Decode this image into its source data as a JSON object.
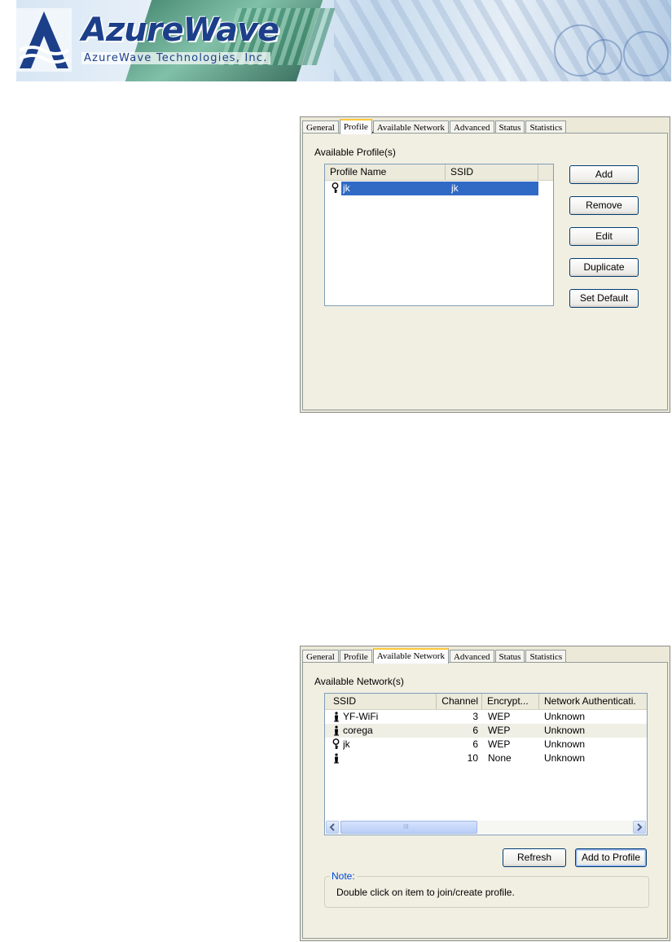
{
  "header": {
    "brand": "AzureWave",
    "company": "AzureWave  Technologies,  Inc."
  },
  "profile_panel": {
    "tabs": [
      "General",
      "Profile",
      "Available Network",
      "Advanced",
      "Status",
      "Statistics"
    ],
    "active_tab": "Profile",
    "group_label": "Available Profile(s)",
    "columns": [
      "Profile Name",
      "SSID"
    ],
    "rows": [
      {
        "name": "jk",
        "ssid": "jk",
        "icon": "key-icon",
        "selected": true
      }
    ],
    "buttons": {
      "add": "Add",
      "remove": "Remove",
      "edit": "Edit",
      "duplicate": "Duplicate",
      "set_default": "Set Default"
    }
  },
  "network_panel": {
    "tabs": [
      "General",
      "Profile",
      "Available Network",
      "Advanced",
      "Status",
      "Statistics"
    ],
    "active_tab": "Available Network",
    "group_label": "Available Network(s)",
    "columns": [
      "SSID",
      "Channel",
      "Encrypt...",
      "Network Authenticati."
    ],
    "rows": [
      {
        "ssid": "YF-WiFi",
        "channel": "3",
        "encryption": "WEP",
        "auth": "Unknown",
        "icon": "access-point-icon"
      },
      {
        "ssid": "corega",
        "channel": "6",
        "encryption": "WEP",
        "auth": "Unknown",
        "icon": "access-point-icon"
      },
      {
        "ssid": "jk",
        "channel": "6",
        "encryption": "WEP",
        "auth": "Unknown",
        "icon": "key-icon"
      },
      {
        "ssid": "",
        "channel": "10",
        "encryption": "None",
        "auth": "Unknown",
        "icon": "access-point-icon"
      }
    ],
    "scroll_grip": "III",
    "buttons": {
      "refresh": "Refresh",
      "add_to_profile": "Add to Profile"
    },
    "note": {
      "legend": "Note:",
      "text": "Double click on item to join/create profile."
    }
  },
  "colors": {
    "brand_blue": "#1c3f8a",
    "selection": "#316ac5",
    "dialog_face": "#ece9d8",
    "tab_highlight": "#ffc83c",
    "note_blue": "#0046d5"
  }
}
